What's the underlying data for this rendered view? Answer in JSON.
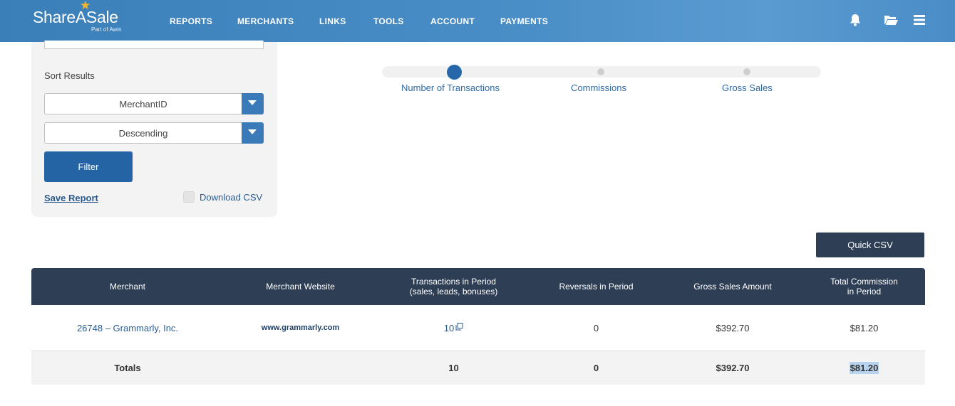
{
  "header": {
    "logo_text": "ShareASale",
    "logo_sub": "Part of Awin",
    "nav": [
      "REPORTS",
      "MERCHANTS",
      "LINKS",
      "TOOLS",
      "ACCOUNT",
      "PAYMENTS"
    ],
    "icons": [
      "bell-icon",
      "folder-open-icon",
      "menu-icon"
    ]
  },
  "filters": {
    "sort_label": "Sort Results",
    "sort_by": "MerchantID",
    "sort_order": "Descending",
    "filter_label": "Filter",
    "save_report": "Save Report",
    "download_csv": "Download CSV"
  },
  "stepper": {
    "steps": [
      "Number of Transactions",
      "Commissions",
      "Gross Sales"
    ],
    "active": 0
  },
  "quick_csv": "Quick CSV",
  "table": {
    "columns": [
      "Merchant",
      "Merchant Website",
      "Transactions in Period\n(sales, leads, bonuses)",
      "Reversals in Period",
      "Gross Sales Amount",
      "Total Commission\nin Period"
    ],
    "rows": [
      {
        "merchant": "26748 – Grammarly, Inc.",
        "website": "www.grammarly.com",
        "transactions": "10",
        "reversals": "0",
        "gross_sales": "$392.70",
        "commission": "$81.20"
      }
    ],
    "totals": {
      "label": "Totals",
      "transactions": "10",
      "reversals": "0",
      "gross_sales": "$392.70",
      "commission": "$81.20"
    }
  },
  "colors": {
    "header_blue": "#3b7fb9",
    "table_header": "#2e3e55",
    "button_blue": "#2464a4",
    "link_blue": "#2a5a8f",
    "logo_star": "#f3b52a"
  }
}
